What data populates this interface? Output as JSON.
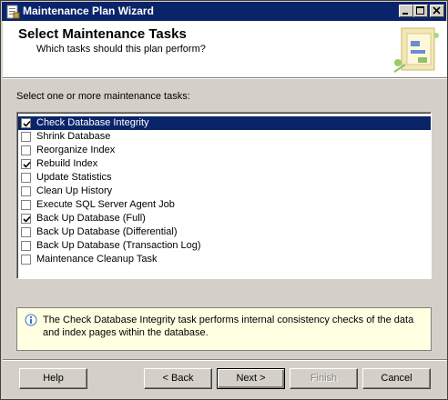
{
  "window": {
    "title": "Maintenance Plan Wizard",
    "controls": {
      "minimize": "_",
      "maximize": "□",
      "close": "×"
    }
  },
  "header": {
    "title": "Select Maintenance Tasks",
    "subtitle": "Which tasks should this plan perform?"
  },
  "instruction": "Select one or more maintenance tasks:",
  "tasks": [
    {
      "label": "Check Database Integrity",
      "checked": true,
      "selected": true
    },
    {
      "label": "Shrink Database",
      "checked": false,
      "selected": false
    },
    {
      "label": "Reorganize Index",
      "checked": false,
      "selected": false
    },
    {
      "label": "Rebuild Index",
      "checked": true,
      "selected": false
    },
    {
      "label": "Update Statistics",
      "checked": false,
      "selected": false
    },
    {
      "label": "Clean Up History",
      "checked": false,
      "selected": false
    },
    {
      "label": "Execute SQL Server Agent Job",
      "checked": false,
      "selected": false
    },
    {
      "label": "Back Up Database (Full)",
      "checked": true,
      "selected": false
    },
    {
      "label": "Back Up Database (Differential)",
      "checked": false,
      "selected": false
    },
    {
      "label": "Back Up Database (Transaction Log)",
      "checked": false,
      "selected": false
    },
    {
      "label": "Maintenance Cleanup Task",
      "checked": false,
      "selected": false
    }
  ],
  "description": "The Check Database Integrity task performs internal consistency checks of the data and index pages within the database.",
  "buttons": {
    "help": "Help",
    "back": "< Back",
    "next": "Next >",
    "finish": "Finish",
    "cancel": "Cancel"
  },
  "icons": {
    "app": "wizard-app-icon",
    "info": "info-icon",
    "header_graphic": "wizard-banner-graphic",
    "check": "checkmark-icon"
  },
  "colors": {
    "titlebar": "#0a246a",
    "selection": "#0a246a",
    "face": "#d4d0c8",
    "tooltip_bg": "#ffffe1"
  }
}
